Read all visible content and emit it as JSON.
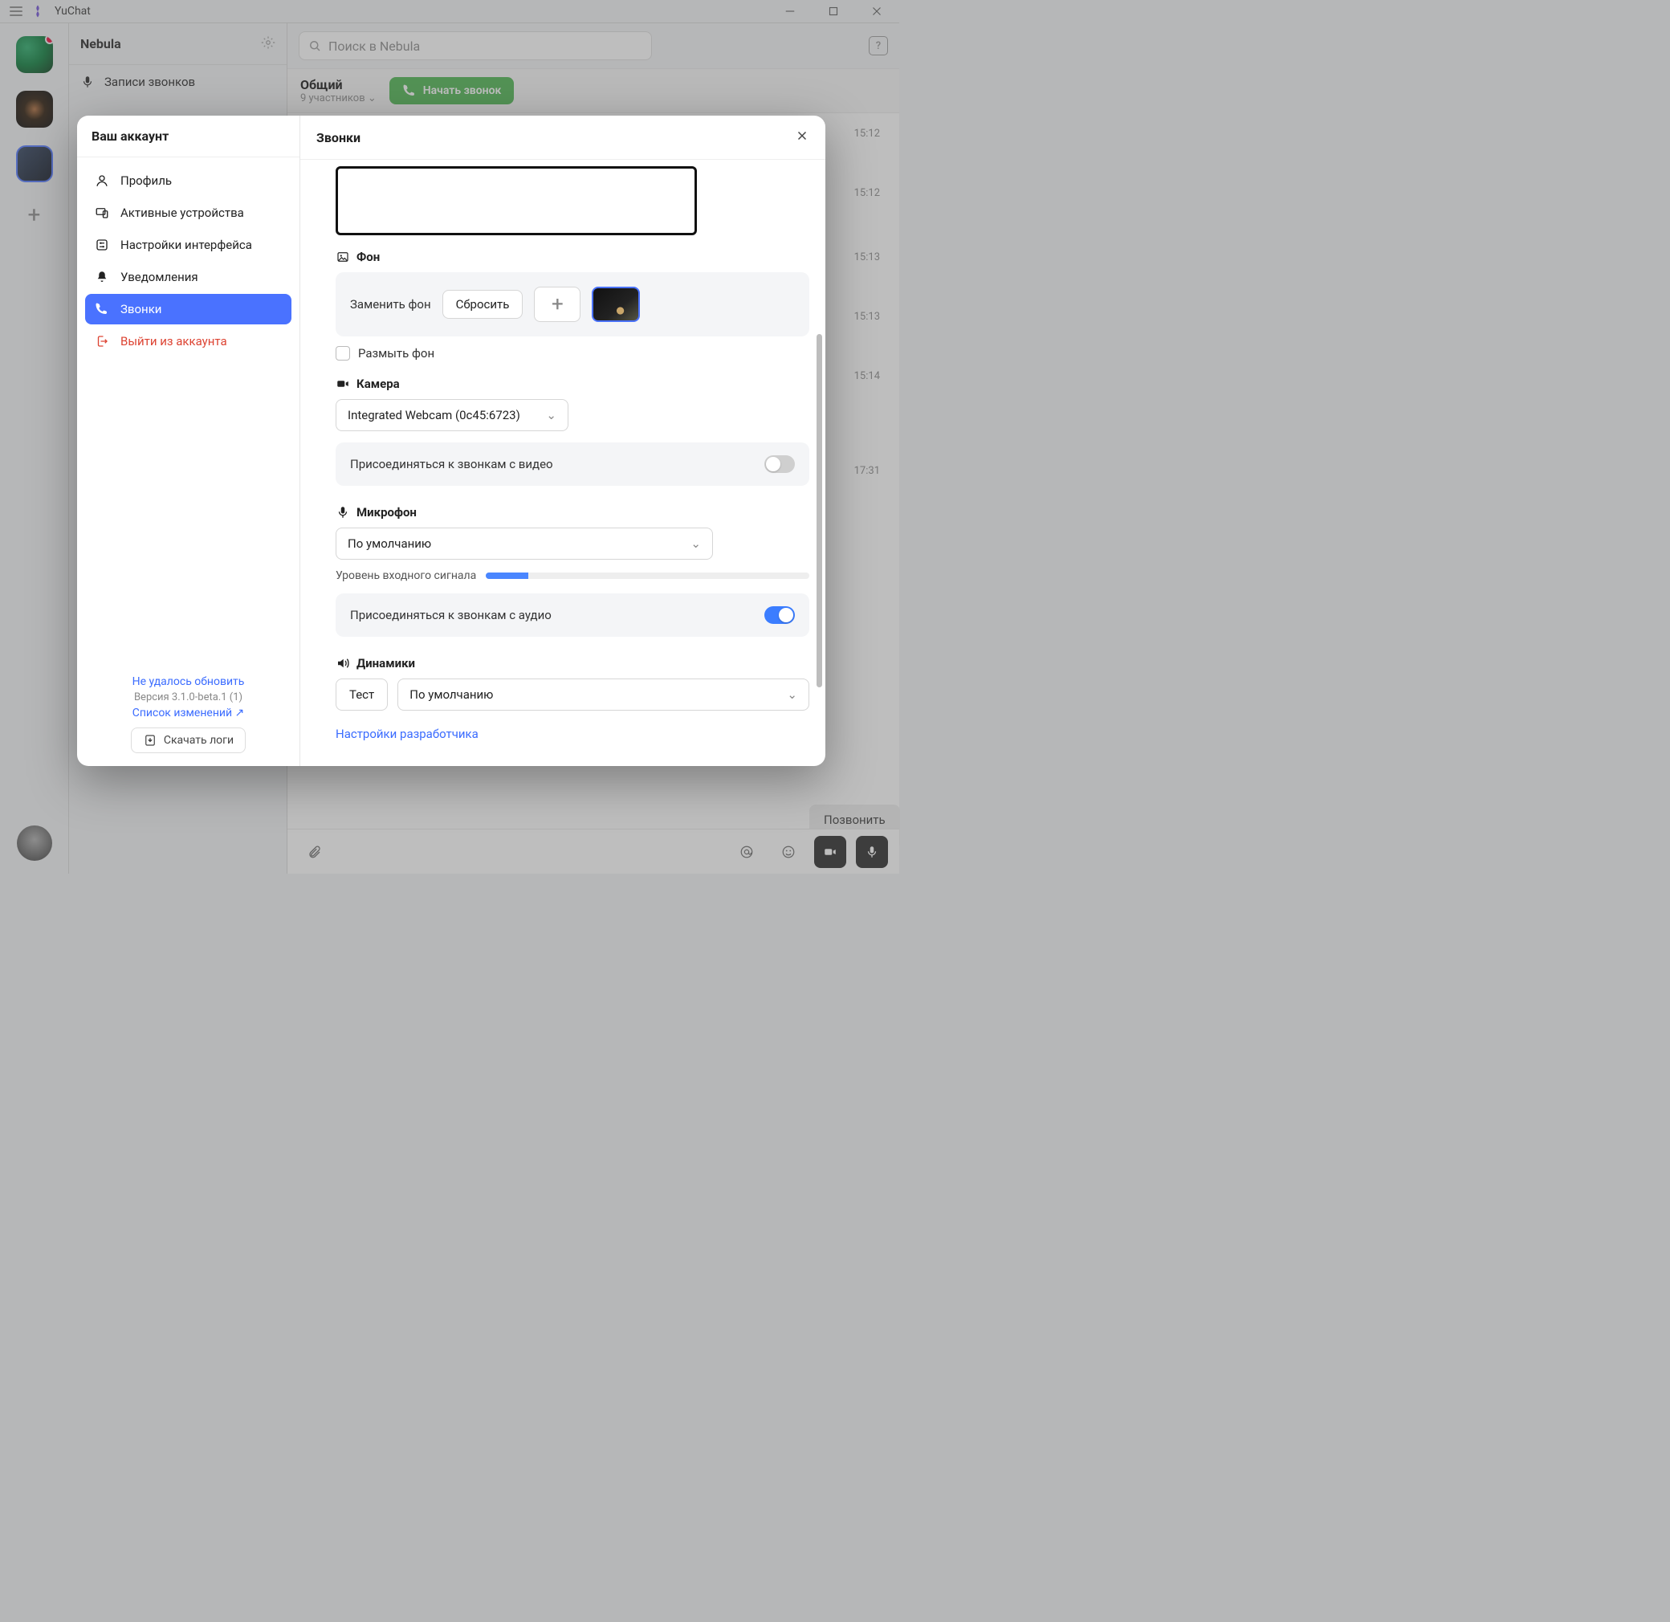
{
  "app": {
    "name": "YuChat"
  },
  "workspace": {
    "name": "Nebula"
  },
  "sidebar_mid": {
    "recordings": "Записи звонков"
  },
  "search": {
    "placeholder": "Поиск в Nebula"
  },
  "channel": {
    "name": "Общий",
    "members": "9 участников",
    "start_call": "Начать звонок"
  },
  "messages": {
    "times": [
      "15:12",
      "15:12",
      "15:13",
      "15:13",
      "15:14",
      "17:31"
    ],
    "call_again": "Позвонить снова"
  },
  "settings": {
    "your_account": "Ваш аккаунт",
    "items": {
      "profile": "Профиль",
      "devices": "Активные устройства",
      "ui": "Настройки интерфейса",
      "notifications": "Уведомления",
      "calls": "Звонки",
      "logout": "Выйти из аккаунта"
    },
    "footer": {
      "update_fail": "Не удалось обновить",
      "version": "Версия 3.1.0-beta.1 (1)",
      "changelog": "Список изменений ↗",
      "download_logs": "Скачать логи"
    },
    "calls_panel": {
      "title": "Звонки",
      "background": {
        "label": "Фон",
        "replace": "Заменить фон",
        "reset": "Сбросить",
        "blur": "Размыть фон"
      },
      "camera": {
        "label": "Камера",
        "device": "Integrated Webcam (0c45:6723)",
        "join_video": "Присоединяться к звонкам с видео"
      },
      "mic": {
        "label": "Микрофон",
        "device": "По умолчанию",
        "level_label": "Уровень входного сигнала",
        "join_audio": "Присоединяться к звонкам с аудио"
      },
      "speakers": {
        "label": "Динамики",
        "test": "Тест",
        "device": "По умолчанию"
      },
      "dev_settings": "Настройки разработчика"
    }
  }
}
